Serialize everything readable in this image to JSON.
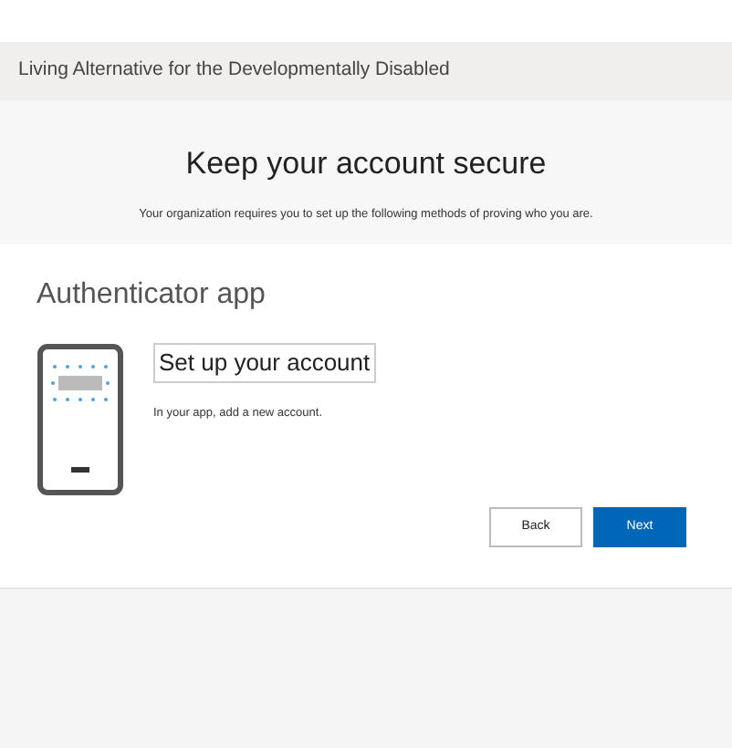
{
  "header": {
    "organization": "Living Alternative for the Developmentally Disabled"
  },
  "page": {
    "title": "Keep your account secure",
    "subtitle": "Your organization requires you to set up the following methods of proving who you are."
  },
  "method": {
    "title": "Authenticator app",
    "step_title": "Set up your account",
    "instruction": "In your app, add a new account."
  },
  "buttons": [
    {
      "label": "Back",
      "kind": "secondary"
    },
    {
      "label": "Next",
      "kind": "primary"
    }
  ]
}
